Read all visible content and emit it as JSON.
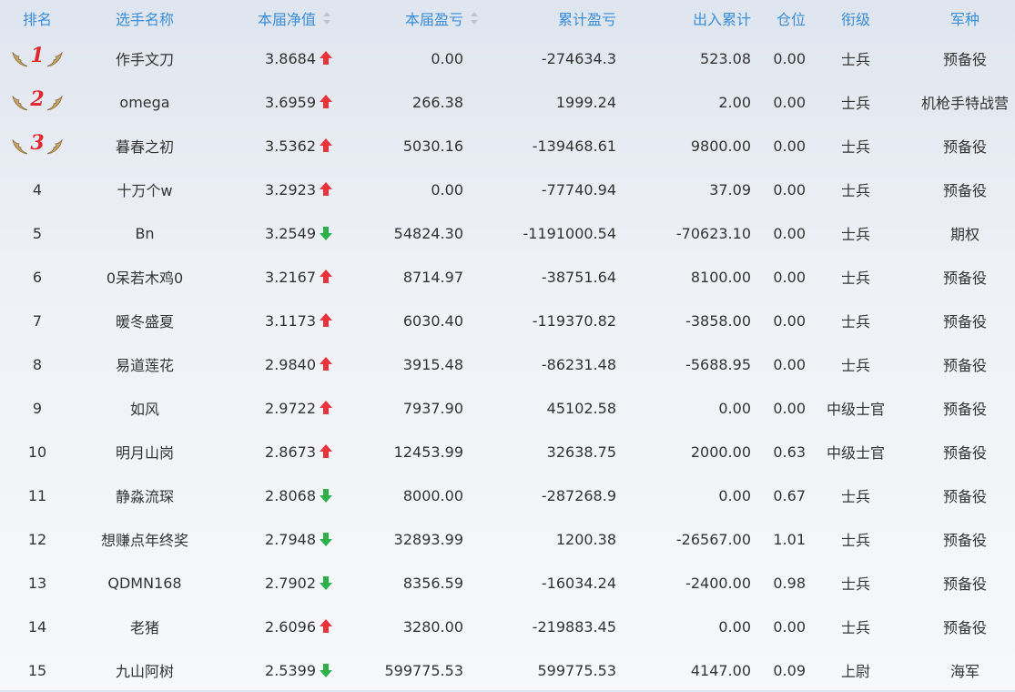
{
  "header": {
    "rank": "排名",
    "name": "选手名称",
    "nav": "本届净值",
    "pnl": "本届盈亏",
    "cum": "累计盈亏",
    "flow": "出入累计",
    "pos": "仓位",
    "grade": "衔级",
    "army": "军种"
  },
  "rows": [
    {
      "rank": "1",
      "name": "作手文刀",
      "nav": "3.8684",
      "dir": "up",
      "pnl": "0.00",
      "cum": "-274634.3",
      "flow": "523.08",
      "pos": "0.00",
      "grade": "士兵",
      "army": "预备役"
    },
    {
      "rank": "2",
      "name": "omega",
      "nav": "3.6959",
      "dir": "up",
      "pnl": "266.38",
      "cum": "1999.24",
      "flow": "2.00",
      "pos": "0.00",
      "grade": "士兵",
      "army": "机枪手特战营"
    },
    {
      "rank": "3",
      "name": "暮春之初",
      "nav": "3.5362",
      "dir": "up",
      "pnl": "5030.16",
      "cum": "-139468.61",
      "flow": "9800.00",
      "pos": "0.00",
      "grade": "士兵",
      "army": "预备役"
    },
    {
      "rank": "4",
      "name": "十万个w",
      "nav": "3.2923",
      "dir": "up",
      "pnl": "0.00",
      "cum": "-77740.94",
      "flow": "37.09",
      "pos": "0.00",
      "grade": "士兵",
      "army": "预备役"
    },
    {
      "rank": "5",
      "name": "Bn",
      "nav": "3.2549",
      "dir": "down",
      "pnl": "54824.30",
      "cum": "-1191000.54",
      "flow": "-70623.10",
      "pos": "0.00",
      "grade": "士兵",
      "army": "期权"
    },
    {
      "rank": "6",
      "name": "0呆若木鸡0",
      "nav": "3.2167",
      "dir": "up",
      "pnl": "8714.97",
      "cum": "-38751.64",
      "flow": "8100.00",
      "pos": "0.00",
      "grade": "士兵",
      "army": "预备役"
    },
    {
      "rank": "7",
      "name": "暖冬盛夏",
      "nav": "3.1173",
      "dir": "up",
      "pnl": "6030.40",
      "cum": "-119370.82",
      "flow": "-3858.00",
      "pos": "0.00",
      "grade": "士兵",
      "army": "预备役"
    },
    {
      "rank": "8",
      "name": "易道莲花",
      "nav": "2.9840",
      "dir": "up",
      "pnl": "3915.48",
      "cum": "-86231.48",
      "flow": "-5688.95",
      "pos": "0.00",
      "grade": "士兵",
      "army": "预备役"
    },
    {
      "rank": "9",
      "name": "如风",
      "nav": "2.9722",
      "dir": "up",
      "pnl": "7937.90",
      "cum": "45102.58",
      "flow": "0.00",
      "pos": "0.00",
      "grade": "中级士官",
      "army": "预备役"
    },
    {
      "rank": "10",
      "name": "明月山岗",
      "nav": "2.8673",
      "dir": "up",
      "pnl": "12453.99",
      "cum": "32638.75",
      "flow": "2000.00",
      "pos": "0.63",
      "grade": "中级士官",
      "army": "预备役"
    },
    {
      "rank": "11",
      "name": "静淼流琛",
      "nav": "2.8068",
      "dir": "down",
      "pnl": "8000.00",
      "cum": "-287268.9",
      "flow": "0.00",
      "pos": "0.67",
      "grade": "士兵",
      "army": "预备役"
    },
    {
      "rank": "12",
      "name": "想赚点年终奖",
      "nav": "2.7948",
      "dir": "down",
      "pnl": "32893.99",
      "cum": "1200.38",
      "flow": "-26567.00",
      "pos": "1.01",
      "grade": "士兵",
      "army": "预备役"
    },
    {
      "rank": "13",
      "name": "QDMN168",
      "nav": "2.7902",
      "dir": "down",
      "pnl": "8356.59",
      "cum": "-16034.24",
      "flow": "-2400.00",
      "pos": "0.98",
      "grade": "士兵",
      "army": "预备役"
    },
    {
      "rank": "14",
      "name": "老猪",
      "nav": "2.6096",
      "dir": "up",
      "pnl": "3280.00",
      "cum": "-219883.45",
      "flow": "0.00",
      "pos": "0.00",
      "grade": "士兵",
      "army": "预备役"
    },
    {
      "rank": "15",
      "name": "九山阿树",
      "nav": "2.5399",
      "dir": "down",
      "pnl": "599775.53",
      "cum": "599775.53",
      "flow": "4147.00",
      "pos": "0.09",
      "grade": "上尉",
      "army": "海军"
    }
  ]
}
